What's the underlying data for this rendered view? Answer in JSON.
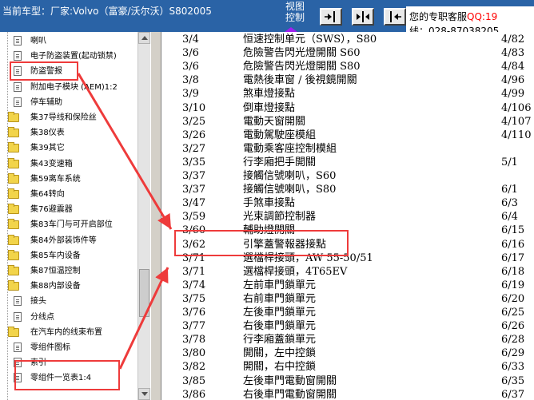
{
  "header": {
    "vehicle_label": "当前车型：厂家:Volvo（富豪/沃尔沃）S802005",
    "view_control_label": "视图控制",
    "support_line1": "您的专职客服",
    "support_qq": "QQ:19",
    "support_line2": "线：028-87038205"
  },
  "tree": {
    "items": [
      {
        "label": "喇叭",
        "icon": "doc-icon"
      },
      {
        "label": "电子防盗装置(起动锁禁)",
        "icon": "doc-icon"
      },
      {
        "label": "防盗警报",
        "icon": "doc-icon"
      },
      {
        "label": "附加电子模块 (AEM)1:2",
        "icon": "doc-icon"
      },
      {
        "label": "停车辅助",
        "icon": "doc-icon"
      },
      {
        "label": "集37导线和保险丝",
        "icon": "folder-icon"
      },
      {
        "label": "集38仪表",
        "icon": "folder-icon"
      },
      {
        "label": "集39其它",
        "icon": "folder-icon"
      },
      {
        "label": "集43变速箱",
        "icon": "folder-icon"
      },
      {
        "label": "集59离车系统",
        "icon": "folder-icon"
      },
      {
        "label": "集64转向",
        "icon": "folder-icon"
      },
      {
        "label": "集76避震器",
        "icon": "folder-icon"
      },
      {
        "label": "集83车门与可开启部位",
        "icon": "folder-icon"
      },
      {
        "label": "集84外部装饰件等",
        "icon": "folder-icon"
      },
      {
        "label": "集85车内设备",
        "icon": "folder-icon"
      },
      {
        "label": "集87恒温控制",
        "icon": "folder-icon"
      },
      {
        "label": "集88内部设备",
        "icon": "folder-icon"
      },
      {
        "label": "接头",
        "icon": "doc-icon"
      },
      {
        "label": "分线点",
        "icon": "doc-icon"
      },
      {
        "label": "在汽车内的线束布置",
        "icon": "folder-icon"
      },
      {
        "label": "零组件图标",
        "icon": "doc-icon"
      },
      {
        "label": "索引",
        "icon": "doc-icon"
      },
      {
        "label": "零组件一览表1:4",
        "icon": "doc-icon"
      }
    ]
  },
  "table": {
    "rows": [
      {
        "code": "3/4",
        "name": "恒速控制单元（SWS），S80",
        "page": "4/82"
      },
      {
        "code": "3/6",
        "name": "危險警告閃光燈開關 S60",
        "page": "4/83"
      },
      {
        "code": "3/6",
        "name": "危險警告閃光燈開關 S80",
        "page": "4/84"
      },
      {
        "code": "3/8",
        "name": "電熱後車窗 / 後視鏡開關",
        "page": "4/96"
      },
      {
        "code": "3/9",
        "name": "煞車燈接點",
        "page": "4/99"
      },
      {
        "code": "3/10",
        "name": "倒車燈接點",
        "page": "4/106"
      },
      {
        "code": "3/25",
        "name": "電動天窗開關",
        "page": "4/107"
      },
      {
        "code": "3/26",
        "name": "電動駕駛座模組",
        "page": "4/110"
      },
      {
        "code": "3/27",
        "name": "電動乘客座控制模組",
        "page": ""
      },
      {
        "code": "3/35",
        "name": "行李廂把手開關",
        "page": "5/1"
      },
      {
        "code": "3/37",
        "name": "接觸信號喇叭，S60",
        "page": ""
      },
      {
        "code": "3/37",
        "name": "接觸信號喇叭，S80",
        "page": "6/1"
      },
      {
        "code": "3/47",
        "name": "手煞車接點",
        "page": "6/3"
      },
      {
        "code": "3/59",
        "name": "光束調節控制器",
        "page": "6/4"
      },
      {
        "code": "3/60",
        "name": "輔助燈開關",
        "page": "6/15"
      },
      {
        "code": "3/62",
        "name": "引擎蓋警報器接點",
        "page": "6/16"
      },
      {
        "code": "3/71",
        "name": "選檔桿接頭，AW 55-50/51",
        "page": "6/17"
      },
      {
        "code": "3/71",
        "name": "選檔桿接頭，4T65EV",
        "page": "6/18"
      },
      {
        "code": "3/74",
        "name": "左前車門鎖單元",
        "page": "6/19"
      },
      {
        "code": "3/75",
        "name": "右前車門鎖單元",
        "page": "6/20"
      },
      {
        "code": "3/76",
        "name": "左後車門鎖單元",
        "page": "6/25"
      },
      {
        "code": "3/77",
        "name": "右後車門鎖單元",
        "page": "6/26"
      },
      {
        "code": "3/78",
        "name": "行李廂蓋鎖單元",
        "page": "6/28"
      },
      {
        "code": "3/80",
        "name": "開關，左中控鎖",
        "page": "6/29"
      },
      {
        "code": "3/82",
        "name": "開關，右中控鎖",
        "page": "6/33"
      },
      {
        "code": "3/85",
        "name": "左後車門電動窗開關",
        "page": "6/35"
      },
      {
        "code": "3/86",
        "name": "右後車門電動窗開關",
        "page": "6/37"
      }
    ]
  },
  "colors": {
    "header_bg": "#2a63a6",
    "annotation_red": "#ee3b3b",
    "qq_red": "#ff0000"
  }
}
